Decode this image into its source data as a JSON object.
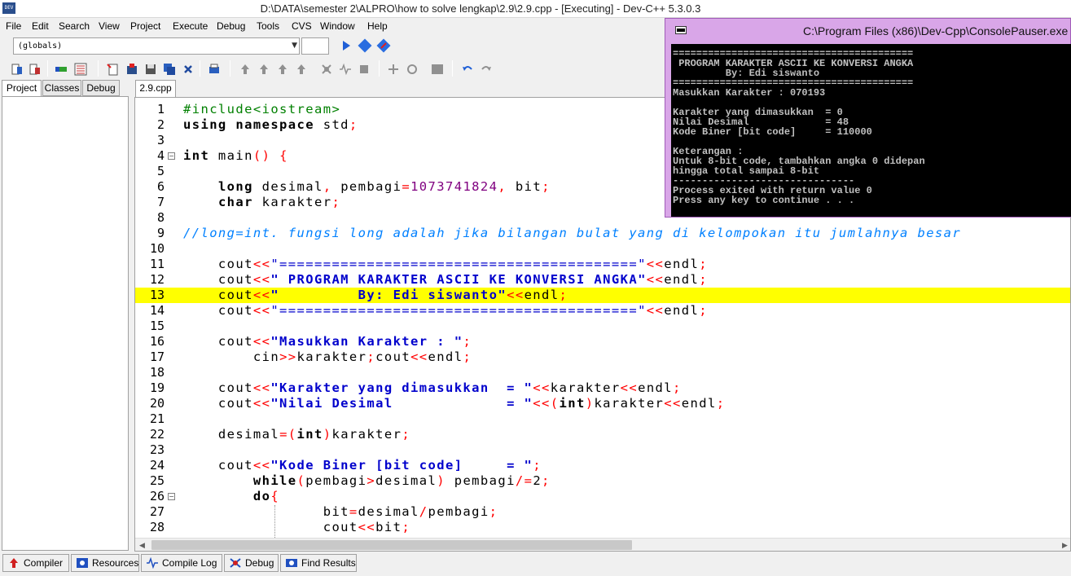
{
  "window": {
    "title": "D:\\DATA\\semester 2\\ALPRO\\how to solve lengkap\\2.9\\2.9.cpp - [Executing] - Dev-C++ 5.3.0.3",
    "app_icon_text": "DEV"
  },
  "menu": [
    "File",
    "Edit",
    "Search",
    "View",
    "Project",
    "Execute",
    "Debug",
    "Tools",
    "CVS",
    "Window",
    "Help"
  ],
  "toolbar": {
    "scope_combo": "(globals)",
    "function_combo": ""
  },
  "left_tabs": [
    "Project",
    "Classes",
    "Debug"
  ],
  "editor_tab": "2.9.cpp",
  "highlighted_line": 13,
  "code_lines": [
    {
      "n": "1",
      "tokens": [
        [
          "pp",
          "#include<iostream>"
        ]
      ]
    },
    {
      "n": "2",
      "tokens": [
        [
          "k",
          "using namespace"
        ],
        [
          "",
          " std"
        ],
        [
          "sym",
          ";"
        ]
      ]
    },
    {
      "n": "3",
      "tokens": []
    },
    {
      "n": "4",
      "fold": true,
      "tokens": [
        [
          "k",
          "int"
        ],
        [
          "",
          " main"
        ],
        [
          "sym",
          "()"
        ],
        [
          "",
          " "
        ],
        [
          "sym",
          "{"
        ]
      ]
    },
    {
      "n": "5",
      "tokens": []
    },
    {
      "n": "6",
      "tokens": [
        [
          "",
          "    "
        ],
        [
          "k",
          "long"
        ],
        [
          "",
          " desimal"
        ],
        [
          "sym",
          ","
        ],
        [
          "",
          " pembagi"
        ],
        [
          "sym",
          "="
        ],
        [
          "num",
          "1073741824"
        ],
        [
          "sym",
          ","
        ],
        [
          "",
          " bit"
        ],
        [
          "sym",
          ";"
        ]
      ]
    },
    {
      "n": "7",
      "tokens": [
        [
          "",
          "    "
        ],
        [
          "k",
          "char"
        ],
        [
          "",
          " karakter"
        ],
        [
          "sym",
          ";"
        ]
      ]
    },
    {
      "n": "8",
      "tokens": []
    },
    {
      "n": "9",
      "tokens": [
        [
          "cm",
          "//long=int. fungsi long adalah jika bilangan bulat yang di kelompokan itu jumlahnya besar"
        ]
      ]
    },
    {
      "n": "10",
      "tokens": []
    },
    {
      "n": "11",
      "tokens": [
        [
          "",
          "    cout"
        ],
        [
          "sym",
          "<<"
        ],
        [
          "sq",
          "\"=========================================\""
        ],
        [
          "sym",
          "<<"
        ],
        [
          "",
          "endl"
        ],
        [
          "sym",
          ";"
        ]
      ]
    },
    {
      "n": "12",
      "tokens": [
        [
          "",
          "    cout"
        ],
        [
          "sym",
          "<<"
        ],
        [
          "s",
          "\" PROGRAM KARAKTER ASCII KE KONVERSI ANGKA\""
        ],
        [
          "sym",
          "<<"
        ],
        [
          "",
          "endl"
        ],
        [
          "sym",
          ";"
        ]
      ]
    },
    {
      "n": "13",
      "tokens": [
        [
          "",
          "    cout"
        ],
        [
          "sym",
          "<<"
        ],
        [
          "s",
          "\"         By: Edi siswanto\""
        ],
        [
          "sym",
          "<<"
        ],
        [
          "",
          "endl"
        ],
        [
          "sym",
          ";"
        ]
      ]
    },
    {
      "n": "14",
      "tokens": [
        [
          "",
          "    cout"
        ],
        [
          "sym",
          "<<"
        ],
        [
          "sq",
          "\"=========================================\""
        ],
        [
          "sym",
          "<<"
        ],
        [
          "",
          "endl"
        ],
        [
          "sym",
          ";"
        ]
      ]
    },
    {
      "n": "15",
      "tokens": []
    },
    {
      "n": "16",
      "tokens": [
        [
          "",
          "    cout"
        ],
        [
          "sym",
          "<<"
        ],
        [
          "s",
          "\"Masukkan Karakter : \""
        ],
        [
          "sym",
          ";"
        ]
      ]
    },
    {
      "n": "17",
      "tokens": [
        [
          "",
          "        cin"
        ],
        [
          "sym",
          ">>"
        ],
        [
          "",
          "karakter"
        ],
        [
          "sym",
          ";"
        ],
        [
          "",
          "cout"
        ],
        [
          "sym",
          "<<"
        ],
        [
          "",
          "endl"
        ],
        [
          "sym",
          ";"
        ]
      ]
    },
    {
      "n": "18",
      "tokens": []
    },
    {
      "n": "19",
      "tokens": [
        [
          "",
          "    cout"
        ],
        [
          "sym",
          "<<"
        ],
        [
          "s",
          "\"Karakter yang dimasukkan  = \""
        ],
        [
          "sym",
          "<<"
        ],
        [
          "",
          "karakter"
        ],
        [
          "sym",
          "<<"
        ],
        [
          "",
          "endl"
        ],
        [
          "sym",
          ";"
        ]
      ]
    },
    {
      "n": "20",
      "tokens": [
        [
          "",
          "    cout"
        ],
        [
          "sym",
          "<<"
        ],
        [
          "s",
          "\"Nilai Desimal             = \""
        ],
        [
          "sym",
          "<<("
        ],
        [
          "k",
          "int"
        ],
        [
          "sym",
          ")"
        ],
        [
          "",
          "karakter"
        ],
        [
          "sym",
          "<<"
        ],
        [
          "",
          "endl"
        ],
        [
          "sym",
          ";"
        ]
      ]
    },
    {
      "n": "21",
      "tokens": []
    },
    {
      "n": "22",
      "tokens": [
        [
          "",
          "    desimal"
        ],
        [
          "sym",
          "=("
        ],
        [
          "k",
          "int"
        ],
        [
          "sym",
          ")"
        ],
        [
          "",
          "karakter"
        ],
        [
          "sym",
          ";"
        ]
      ]
    },
    {
      "n": "23",
      "tokens": []
    },
    {
      "n": "24",
      "tokens": [
        [
          "",
          "    cout"
        ],
        [
          "sym",
          "<<"
        ],
        [
          "s",
          "\"Kode Biner [bit code]     = \""
        ],
        [
          "sym",
          ";"
        ]
      ]
    },
    {
      "n": "25",
      "tokens": [
        [
          "",
          "        "
        ],
        [
          "k",
          "while"
        ],
        [
          "sym",
          "("
        ],
        [
          "",
          "pembagi"
        ],
        [
          "sym",
          ">"
        ],
        [
          "",
          "desimal"
        ],
        [
          "sym",
          ")"
        ],
        [
          "",
          " pembagi"
        ],
        [
          "sym",
          "/="
        ],
        [
          "",
          "2"
        ],
        [
          "sym",
          ";"
        ]
      ]
    },
    {
      "n": "26",
      "fold": true,
      "tokens": [
        [
          "",
          "        "
        ],
        [
          "k",
          "do"
        ],
        [
          "sym",
          "{"
        ]
      ]
    },
    {
      "n": "27",
      "tokens": [
        [
          "",
          "                bit"
        ],
        [
          "sym",
          "="
        ],
        [
          "",
          "desimal"
        ],
        [
          "sym",
          "/"
        ],
        [
          "",
          "pembagi"
        ],
        [
          "sym",
          ";"
        ]
      ]
    },
    {
      "n": "28",
      "tokens": [
        [
          "",
          "                cout"
        ],
        [
          "sym",
          "<<"
        ],
        [
          "",
          "bit"
        ],
        [
          "sym",
          ";"
        ]
      ]
    }
  ],
  "bottom_tabs": [
    "Compiler",
    "Resources",
    "Compile Log",
    "Debug",
    "Find Results"
  ],
  "console": {
    "title": "C:\\Program Files (x86)\\Dev-Cpp\\ConsolePauser.exe",
    "lines": [
      "=========================================",
      " PROGRAM KARAKTER ASCII KE KONVERSI ANGKA",
      "         By: Edi siswanto",
      "=========================================",
      "Masukkan Karakter : 070193",
      "",
      "Karakter yang dimasukkan  = 0",
      "Nilai Desimal             = 48",
      "Kode Biner [bit code]     = 110000",
      "",
      "Keterangan :",
      "Untuk 8-bit code, tambahkan angka 0 didepan",
      "hingga total sampai 8-bit",
      "-------------------------------",
      "Process exited with return value 0",
      "Press any key to continue . . ."
    ]
  },
  "colors": {
    "highlight": "#ffff00",
    "string": "#0000cc",
    "symbol": "#ff0000",
    "number": "#800080",
    "comment": "#0080ff",
    "preprocessor": "#008000",
    "console_frame": "#d9a6e8"
  }
}
